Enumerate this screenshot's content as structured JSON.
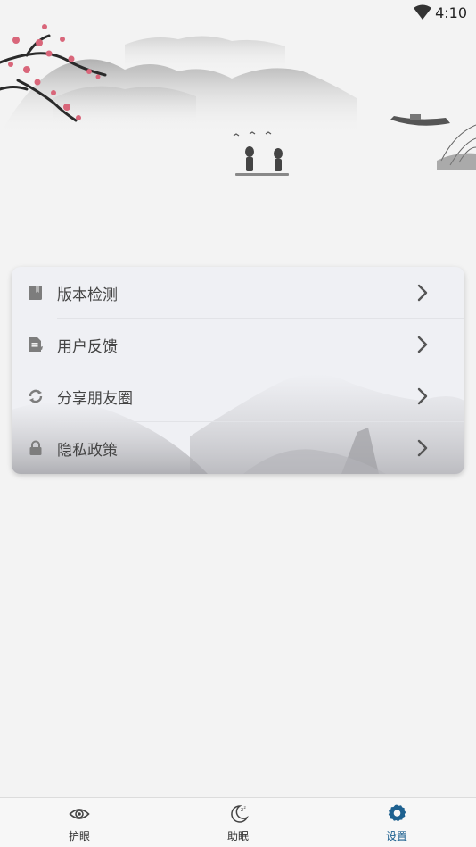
{
  "status_bar": {
    "time": "4:10",
    "wifi_icon": "wifi-icon"
  },
  "settings_menu": {
    "items": [
      {
        "label": "版本检测",
        "icon": "bookmark-icon"
      },
      {
        "label": "用户反馈",
        "icon": "feedback-icon"
      },
      {
        "label": "分享朋友圈",
        "icon": "share-icon"
      },
      {
        "label": "隐私政策",
        "icon": "lock-icon"
      }
    ],
    "chevron_icon": "chevron-right-icon"
  },
  "bottom_nav": {
    "items": [
      {
        "label": "护眼",
        "icon": "eye-icon"
      },
      {
        "label": "助眠",
        "icon": "moon-icon"
      },
      {
        "label": "设置",
        "icon": "gear-icon"
      }
    ],
    "active_index": 2,
    "active_color": "#1e6190",
    "inactive_color": "#333333"
  }
}
